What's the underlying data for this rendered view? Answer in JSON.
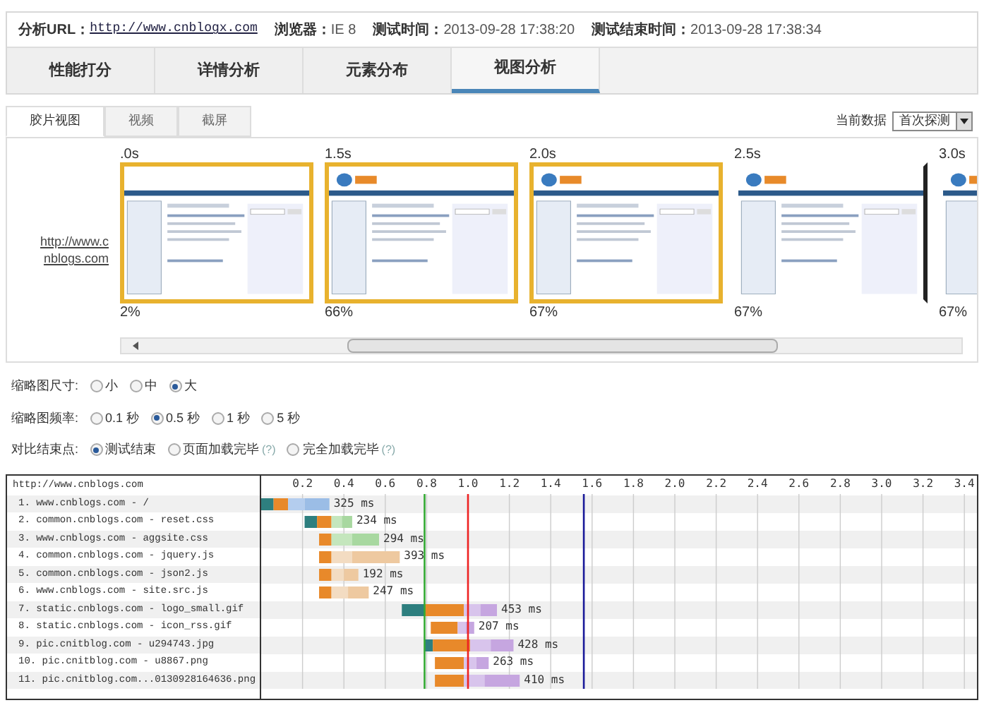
{
  "info_bar": [
    {
      "label": "分析URL：",
      "value": "http://www.cnblogx.com",
      "kind": "link"
    },
    {
      "label": "浏览器：",
      "value": "IE 8",
      "kind": "text"
    },
    {
      "label": "测试时间：",
      "value": "2013-09-28 17:38:20",
      "kind": "text"
    },
    {
      "label": "测试结束时间：",
      "value": "2013-09-28 17:38:34",
      "kind": "text"
    }
  ],
  "main_tabs": [
    {
      "label": "性能打分",
      "selected": false
    },
    {
      "label": "详情分析",
      "selected": false
    },
    {
      "label": "元素分布",
      "selected": false
    },
    {
      "label": "视图分析",
      "selected": true
    }
  ],
  "sub_tabs": [
    {
      "label": "胶片视图",
      "selected": true
    },
    {
      "label": "视频",
      "selected": false
    },
    {
      "label": "截屏",
      "selected": false
    }
  ],
  "current_data": {
    "label": "当前数据",
    "value": "首次探测"
  },
  "filmstrip": {
    "url": "http://www.cnblogs.com",
    "frames": [
      {
        "time": ".0s",
        "percent": "2%",
        "selected": true,
        "loaded": false
      },
      {
        "time": "1.5s",
        "percent": "66%",
        "selected": true,
        "loaded": true
      },
      {
        "time": "2.0s",
        "percent": "67%",
        "selected": true,
        "loaded": true
      },
      {
        "time": "2.5s",
        "percent": "67%",
        "selected": false,
        "loaded": true
      },
      {
        "time": "3.0s",
        "percent": "67%",
        "selected": false,
        "loaded": true
      }
    ]
  },
  "options": [
    {
      "label": "缩略图尺寸:",
      "choices": [
        {
          "label": "小",
          "selected": false
        },
        {
          "label": "中",
          "selected": false
        },
        {
          "label": "大",
          "selected": true
        }
      ]
    },
    {
      "label": "缩略图频率:",
      "choices": [
        {
          "label": "0.1 秒",
          "selected": false
        },
        {
          "label": "0.5 秒",
          "selected": true
        },
        {
          "label": "1 秒",
          "selected": false
        },
        {
          "label": "5 秒",
          "selected": false
        }
      ]
    },
    {
      "label": "对比结束点:",
      "choices": [
        {
          "label": "测试结束",
          "selected": true
        },
        {
          "label": "页面加载完毕",
          "help": "(?)",
          "selected": false
        },
        {
          "label": "完全加载完毕",
          "help": "(?)",
          "selected": false
        }
      ]
    }
  ],
  "waterfall": {
    "title": "http://www.cnblogs.com",
    "requests": [
      {
        "name": "1. www.cnblogs.com - /",
        "time": "325 ms"
      },
      {
        "name": "2. common.cnblogs.com - reset.css",
        "time": "234 ms"
      },
      {
        "name": "3. www.cnblogs.com - aggsite.css",
        "time": "294 ms"
      },
      {
        "name": "4. common.cnblogs.com - jquery.js",
        "time": "393 ms"
      },
      {
        "name": "5. common.cnblogs.com - json2.js",
        "time": "192 ms"
      },
      {
        "name": "6. www.cnblogs.com - site.src.js",
        "time": "247 ms"
      },
      {
        "name": "7. static.cnblogs.com - logo_small.gif",
        "time": "453 ms"
      },
      {
        "name": "8. static.cnblogs.com - icon_rss.gif",
        "time": "207 ms"
      },
      {
        "name": "9. pic.cnitblog.com - u294743.jpg",
        "time": "428 ms"
      },
      {
        "name": "10. pic.cnitblog.com - u8867.png",
        "time": "263 ms"
      },
      {
        "name": "11. pic.cnitblog.com...0130928164636.png",
        "time": "410 ms"
      }
    ],
    "axis_ticks": [
      "0.2",
      "0.4",
      "0.6",
      "0.8",
      "1.0",
      "1.2",
      "1.4",
      "1.6",
      "1.8",
      "2.0",
      "2.2",
      "2.4",
      "2.6",
      "2.8",
      "3.0",
      "3.2",
      "3.4"
    ]
  }
}
